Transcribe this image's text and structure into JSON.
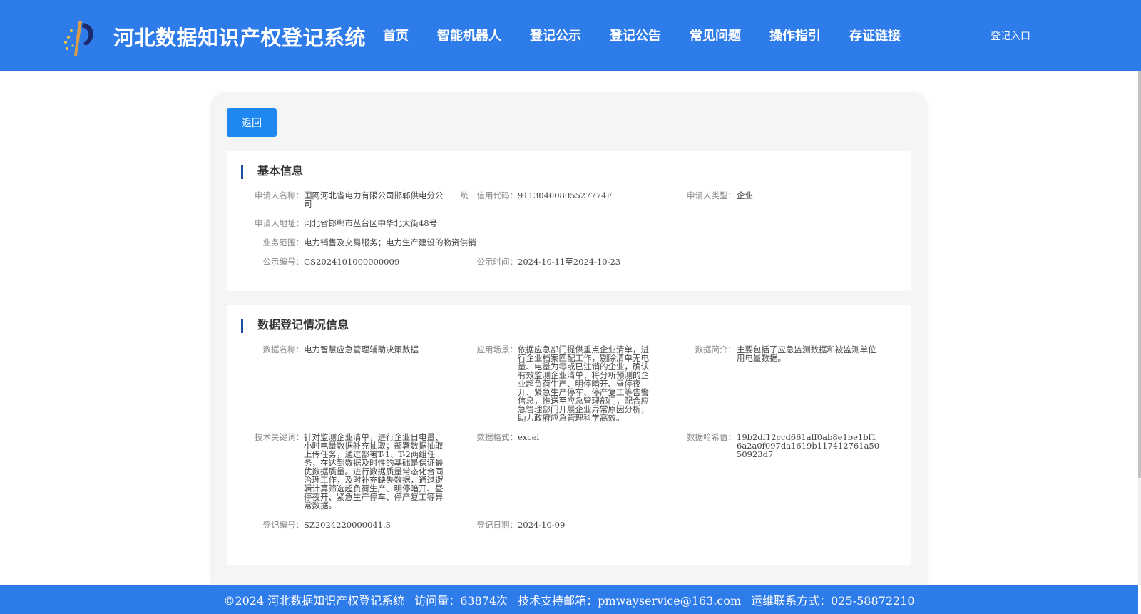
{
  "header": {
    "site_title": "河北数据知识产权登记系统",
    "nav": [
      "首页",
      "智能机器人",
      "登记公示",
      "登记公告",
      "常见问题",
      "操作指引",
      "存证链接"
    ],
    "login": "登记入口",
    "color": "#2e7bea"
  },
  "back_button": "返回",
  "basic": {
    "title": "基本信息",
    "applicant_name_label": "申请人名称：",
    "applicant_name": "国网河北省电力有限公司邯郸供电分公司",
    "credit_code_label": "统一信用代码：",
    "credit_code": "91130400805527774F",
    "applicant_type_label": "申请人类型：",
    "applicant_type": "企业",
    "address_label": "申请人地址：",
    "address": "河北省邯郸市丛台区中华北大街48号",
    "scope_label": "业务范围：",
    "scope": "电力销售及交易服务；电力生产建设的物资供销",
    "notice_no_label": "公示编号：",
    "notice_no": "GS2024101000000009",
    "notice_time_label": "公示时间：",
    "notice_time": "2024-10-11至2024-10-23"
  },
  "registration": {
    "title": "数据登记情况信息",
    "data_name_label": "数据名称：",
    "data_name": "电力智慧应急管理辅助决策数据",
    "scenario_label": "应用场景：",
    "scenario": "依据应急部门提供重点企业清单，进行企业档案匹配工作，剔除清单无电量、电量为零或已注销的企业，确认有效监测企业清单，将分析预测的企业超负荷生产、明停暗开、昼停夜开、紧急生产停车、停产复工等告警信息，推送至应急管理部门，配合应急管理部门开展企业异常原因分析，助力政府应急管理科学高效。",
    "intro_label": "数据简介：",
    "intro": "主要包括了应急监测数据和被监测单位用电量数据。",
    "keywords_label": "技术关键词：",
    "keywords": "针对监测企业清单，进行企业日电量、小时电量数据补充抽取；部署数据抽取上传任务，通过部署T-1、T-2两组任务，在达到数据及时性的基础是保证最优数据质量。进行数据质量常态化合同治理工作，及时补充缺失数据，通过逻辑计算筛选超负荷生产、明停暗开、昼停夜开、紧急生产停车、停产复工等异常数据。",
    "format_label": "数据格式：",
    "format": "excel",
    "hash_label": "数据哈希值：",
    "hash": "19b2df12ccd661aff0ab8e1be1bf16a2a0f097da1619b117412761a5050923d7",
    "reg_no_label": "登记编号：",
    "reg_no": "SZ2024220000041.3",
    "reg_date_label": "登记日期：",
    "reg_date": "2024-10-09"
  },
  "footer": {
    "copyright": "©2024 河北数据知识产权登记系统",
    "visits": "访问量：63874次",
    "email": "技术支持邮箱：pmwayservice@163.com",
    "phone": "运维联系方式：025-58872210"
  }
}
